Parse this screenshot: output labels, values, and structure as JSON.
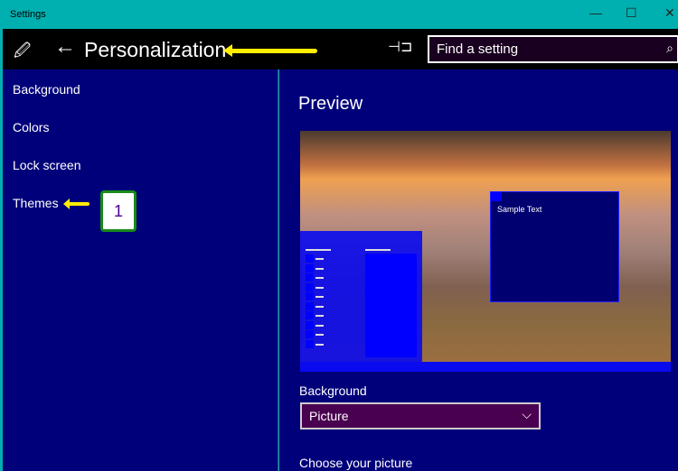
{
  "window": {
    "title": "Settings",
    "minimize": "—",
    "maximize": "☐",
    "close": "✕"
  },
  "header": {
    "title": "Personalization",
    "back": "←",
    "search_placeholder": "Find a setting",
    "pin": "⊣⊐",
    "search_icon": "⌕",
    "app_icon": "🖉"
  },
  "sidebar": {
    "items": [
      {
        "label": "Background"
      },
      {
        "label": "Colors"
      },
      {
        "label": "Lock screen"
      },
      {
        "label": "Themes"
      }
    ]
  },
  "annotation": {
    "badge": "1",
    "arrow_color": "#ffee00"
  },
  "main": {
    "preview_heading": "Preview",
    "sample_text": "Sample Text",
    "background_label": "Background",
    "background_value": "Picture",
    "choose_label": "Choose your picture"
  },
  "colors": {
    "accent": "#0000ff",
    "bg": "#00007a",
    "titlebar": "#00b0b0"
  }
}
